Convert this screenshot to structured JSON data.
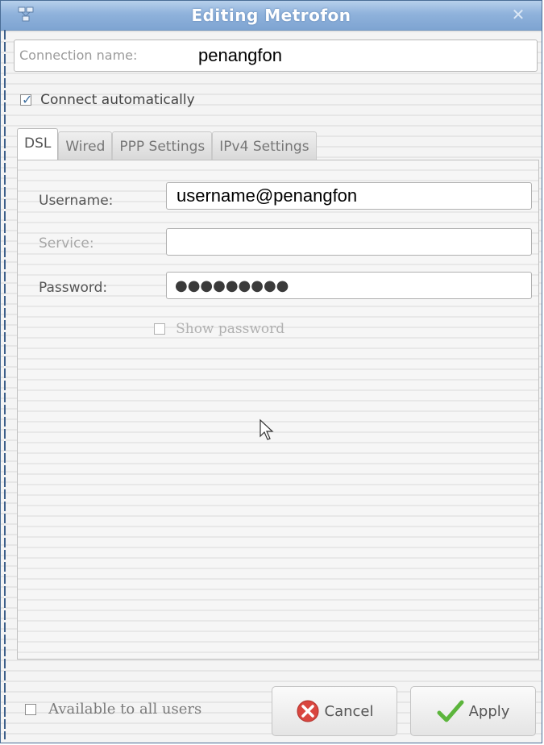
{
  "window": {
    "title": "Editing Metrofon"
  },
  "connection": {
    "name_label": "Connection name:",
    "name_value": "penangfon",
    "auto_label": "Connect automatically",
    "auto_checked": true
  },
  "tabs": [
    {
      "label": "DSL",
      "active": true
    },
    {
      "label": "Wired",
      "active": false
    },
    {
      "label": "PPP Settings",
      "active": false
    },
    {
      "label": "IPv4 Settings",
      "active": false
    }
  ],
  "dsl": {
    "username_label": "Username:",
    "username_value": "username@penangfon",
    "service_label": "Service:",
    "service_value": "",
    "password_label": "Password:",
    "password_mask": "●●●●●●●●●",
    "show_password_label": "Show password"
  },
  "footer": {
    "available_label": "Available to all users",
    "cancel_label": "Cancel",
    "apply_label": "Apply"
  },
  "colors": {
    "titlebar": "#8fb2db",
    "accent": "#3f6f9f",
    "cancel_icon": "#d9463f",
    "apply_icon": "#5cb53c"
  }
}
